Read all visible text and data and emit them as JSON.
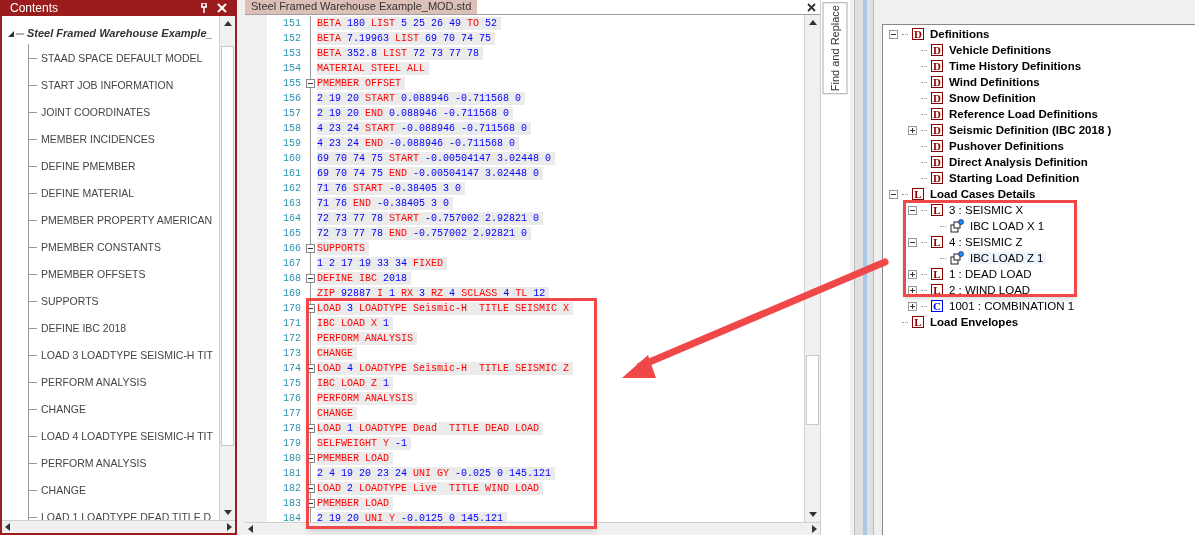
{
  "contents_panel": {
    "title": "Contents",
    "tree": {
      "label": "Steel Framed Warehouse Example_",
      "expanded": true,
      "children": [
        {
          "label": "STAAD SPACE DEFAULT MODEL"
        },
        {
          "label": "START JOB INFORMATION"
        },
        {
          "label": "JOINT COORDINATES"
        },
        {
          "label": "MEMBER INCIDENCES"
        },
        {
          "label": "DEFINE PMEMBER"
        },
        {
          "label": "DEFINE MATERIAL"
        },
        {
          "label": "PMEMBER PROPERTY AMERICAN"
        },
        {
          "label": "PMEMBER CONSTANTS"
        },
        {
          "label": "PMEMBER OFFSETS"
        },
        {
          "label": "SUPPORTS"
        },
        {
          "label": "DEFINE IBC 2018"
        },
        {
          "label": "LOAD 3 LOADTYPE SEISMIC-H TIT"
        },
        {
          "label": "PERFORM ANALYSIS"
        },
        {
          "label": "CHANGE"
        },
        {
          "label": "LOAD 4 LOADTYPE SEISMIC-H TIT"
        },
        {
          "label": "PERFORM ANALYSIS"
        },
        {
          "label": "CHANGE"
        },
        {
          "label": "LOAD 1 LOADTYPE DEAD TITLE D"
        }
      ]
    }
  },
  "editor": {
    "tab": "Steel Framed Warehouse Example_MOD.std",
    "lines": [
      {
        "number": "151",
        "fold": false,
        "segments": [
          {
            "text": "BETA ",
            "kind": "keyword"
          },
          {
            "text": "180 ",
            "kind": "number"
          },
          {
            "text": "LIST ",
            "kind": "keyword"
          },
          {
            "text": "5 25 26 49 ",
            "kind": "number"
          },
          {
            "text": "TO ",
            "kind": "keyword"
          },
          {
            "text": "52",
            "kind": "number"
          }
        ]
      },
      {
        "number": "152",
        "fold": false,
        "segments": [
          {
            "text": "BETA ",
            "kind": "keyword"
          },
          {
            "text": "7.19963 ",
            "kind": "number"
          },
          {
            "text": "LIST ",
            "kind": "keyword"
          },
          {
            "text": "69 70 74 75",
            "kind": "number"
          }
        ]
      },
      {
        "number": "153",
        "fold": false,
        "segments": [
          {
            "text": "BETA ",
            "kind": "keyword"
          },
          {
            "text": "352.8 ",
            "kind": "number"
          },
          {
            "text": "LIST ",
            "kind": "keyword"
          },
          {
            "text": "72 73 77 78",
            "kind": "number"
          }
        ]
      },
      {
        "number": "154",
        "fold": false,
        "segments": [
          {
            "text": "MATERIAL STEEL ALL",
            "kind": "keyword"
          }
        ]
      },
      {
        "number": "155",
        "fold": true,
        "segments": [
          {
            "text": "PMEMBER OFFSET",
            "kind": "keyword"
          }
        ]
      },
      {
        "number": "156",
        "fold": false,
        "segments": [
          {
            "text": "2 19 20 ",
            "kind": "number"
          },
          {
            "text": "START ",
            "kind": "keyword"
          },
          {
            "text": "0.088946 -0.711568 0",
            "kind": "number"
          }
        ]
      },
      {
        "number": "157",
        "fold": false,
        "segments": [
          {
            "text": "2 19 20 ",
            "kind": "number"
          },
          {
            "text": "END ",
            "kind": "keyword"
          },
          {
            "text": "0.088946 -0.711568 0",
            "kind": "number"
          }
        ]
      },
      {
        "number": "158",
        "fold": false,
        "segments": [
          {
            "text": "4 23 24 ",
            "kind": "number"
          },
          {
            "text": "START ",
            "kind": "keyword"
          },
          {
            "text": "-0.088946 -0.711568 0",
            "kind": "number"
          }
        ]
      },
      {
        "number": "159",
        "fold": false,
        "segments": [
          {
            "text": "4 23 24 ",
            "kind": "number"
          },
          {
            "text": "END ",
            "kind": "keyword"
          },
          {
            "text": "-0.088946 -0.711568 0",
            "kind": "number"
          }
        ]
      },
      {
        "number": "160",
        "fold": false,
        "segments": [
          {
            "text": "69 70 74 75 ",
            "kind": "number"
          },
          {
            "text": "START ",
            "kind": "keyword"
          },
          {
            "text": "-0.00504147 3.02448 0",
            "kind": "number"
          }
        ]
      },
      {
        "number": "161",
        "fold": false,
        "segments": [
          {
            "text": "69 70 74 75 ",
            "kind": "number"
          },
          {
            "text": "END ",
            "kind": "keyword"
          },
          {
            "text": "-0.00504147 3.02448 0",
            "kind": "number"
          }
        ]
      },
      {
        "number": "162",
        "fold": false,
        "segments": [
          {
            "text": "71 76 ",
            "kind": "number"
          },
          {
            "text": "START ",
            "kind": "keyword"
          },
          {
            "text": "-0.38405 3 0",
            "kind": "number"
          }
        ]
      },
      {
        "number": "163",
        "fold": false,
        "segments": [
          {
            "text": "71 76 ",
            "kind": "number"
          },
          {
            "text": "END ",
            "kind": "keyword"
          },
          {
            "text": "-0.38405 3 0",
            "kind": "number"
          }
        ]
      },
      {
        "number": "164",
        "fold": false,
        "segments": [
          {
            "text": "72 73 77 78 ",
            "kind": "number"
          },
          {
            "text": "START ",
            "kind": "keyword"
          },
          {
            "text": "-0.757002 2.92821 0",
            "kind": "number"
          }
        ]
      },
      {
        "number": "165",
        "fold": false,
        "segments": [
          {
            "text": "72 73 77 78 ",
            "kind": "number"
          },
          {
            "text": "END ",
            "kind": "keyword"
          },
          {
            "text": "-0.757002 2.92821 0",
            "kind": "number"
          }
        ]
      },
      {
        "number": "166",
        "fold": true,
        "segments": [
          {
            "text": "SUPPORTS",
            "kind": "keyword"
          }
        ]
      },
      {
        "number": "167",
        "fold": false,
        "segments": [
          {
            "text": "1 2 17 19 33 34 ",
            "kind": "number"
          },
          {
            "text": "FIXED",
            "kind": "keyword"
          }
        ]
      },
      {
        "number": "168",
        "fold": true,
        "segments": [
          {
            "text": "DEFINE IBC ",
            "kind": "keyword"
          },
          {
            "text": "2018",
            "kind": "number"
          }
        ]
      },
      {
        "number": "169",
        "fold": false,
        "segments": [
          {
            "text": "ZIP ",
            "kind": "keyword"
          },
          {
            "text": "92887 ",
            "kind": "number"
          },
          {
            "text": "I ",
            "kind": "keyword"
          },
          {
            "text": "1 ",
            "kind": "number"
          },
          {
            "text": "RX ",
            "kind": "keyword"
          },
          {
            "text": "3 ",
            "kind": "number"
          },
          {
            "text": "RZ ",
            "kind": "keyword"
          },
          {
            "text": "4 ",
            "kind": "number"
          },
          {
            "text": "SCLASS ",
            "kind": "keyword"
          },
          {
            "text": "4 ",
            "kind": "number"
          },
          {
            "text": "TL ",
            "kind": "keyword"
          },
          {
            "text": "12",
            "kind": "number"
          }
        ]
      },
      {
        "number": "170",
        "fold": true,
        "segments": [
          {
            "text": "LOAD ",
            "kind": "keyword"
          },
          {
            "text": "3 ",
            "kind": "number"
          },
          {
            "text": "LOADTYPE Seismic-H  TITLE SEISMIC X",
            "kind": "keyword"
          }
        ]
      },
      {
        "number": "171",
        "fold": false,
        "segments": [
          {
            "text": "IBC LOAD X ",
            "kind": "keyword"
          },
          {
            "text": "1",
            "kind": "number"
          }
        ]
      },
      {
        "number": "172",
        "fold": false,
        "segments": [
          {
            "text": "PERFORM ANALYSIS",
            "kind": "keyword"
          }
        ]
      },
      {
        "number": "173",
        "fold": false,
        "segments": [
          {
            "text": "CHANGE",
            "kind": "keyword"
          }
        ]
      },
      {
        "number": "174",
        "fold": true,
        "segments": [
          {
            "text": "LOAD ",
            "kind": "keyword"
          },
          {
            "text": "4 ",
            "kind": "number"
          },
          {
            "text": "LOADTYPE Seismic-H  TITLE SEISMIC Z",
            "kind": "keyword"
          }
        ]
      },
      {
        "number": "175",
        "fold": false,
        "segments": [
          {
            "text": "IBC LOAD Z ",
            "kind": "keyword"
          },
          {
            "text": "1",
            "kind": "number"
          }
        ]
      },
      {
        "number": "176",
        "fold": false,
        "segments": [
          {
            "text": "PERFORM ANALYSIS",
            "kind": "keyword"
          }
        ]
      },
      {
        "number": "177",
        "fold": false,
        "segments": [
          {
            "text": "CHANGE",
            "kind": "keyword"
          }
        ]
      },
      {
        "number": "178",
        "fold": true,
        "segments": [
          {
            "text": "LOAD ",
            "kind": "keyword"
          },
          {
            "text": "1 ",
            "kind": "number"
          },
          {
            "text": "LOADTYPE Dead  TITLE DEAD LOAD",
            "kind": "keyword"
          }
        ]
      },
      {
        "number": "179",
        "fold": false,
        "segments": [
          {
            "text": "SELFWEIGHT Y ",
            "kind": "keyword"
          },
          {
            "text": "-1",
            "kind": "number"
          }
        ]
      },
      {
        "number": "180",
        "fold": true,
        "segments": [
          {
            "text": "PMEMBER LOAD",
            "kind": "keyword"
          }
        ]
      },
      {
        "number": "181",
        "fold": false,
        "segments": [
          {
            "text": "2 4 19 20 23 24 ",
            "kind": "number"
          },
          {
            "text": "UNI GY ",
            "kind": "keyword"
          },
          {
            "text": "-0.025 0 145.121",
            "kind": "number"
          }
        ]
      },
      {
        "number": "182",
        "fold": true,
        "segments": [
          {
            "text": "LOAD ",
            "kind": "keyword"
          },
          {
            "text": "2 ",
            "kind": "number"
          },
          {
            "text": "LOADTYPE Live  TITLE WIND LOAD",
            "kind": "keyword"
          }
        ]
      },
      {
        "number": "183",
        "fold": true,
        "segments": [
          {
            "text": "PMEMBER LOAD",
            "kind": "keyword"
          }
        ]
      },
      {
        "number": "184",
        "fold": false,
        "segments": [
          {
            "text": "2 19 20 ",
            "kind": "number"
          },
          {
            "text": "UNI Y ",
            "kind": "keyword"
          },
          {
            "text": "-0.0125 0 145.121",
            "kind": "number"
          }
        ]
      }
    ]
  },
  "side_tab": {
    "label": "Find and Replace"
  },
  "load_tree": [
    {
      "label": "Definitions",
      "badge": "D",
      "color": "#8b0000",
      "bold": true,
      "expanded": true,
      "children": [
        {
          "label": "Vehicle Definitions",
          "badge": "D",
          "color": "#8b0000",
          "bold": true
        },
        {
          "label": "Time History Definitions",
          "badge": "D",
          "color": "#8b0000",
          "bold": true
        },
        {
          "label": "Wind Definitions",
          "badge": "D",
          "color": "#8b0000",
          "bold": true
        },
        {
          "label": "Snow Definition",
          "badge": "D",
          "color": "#8b0000",
          "bold": true
        },
        {
          "label": "Reference Load Definitions",
          "badge": "D",
          "color": "#8b0000",
          "bold": true
        },
        {
          "label": "Seismic Definition (IBC 2018 )",
          "badge": "D",
          "color": "#8b0000",
          "bold": true,
          "expanded": false
        },
        {
          "label": "Pushover Definitions",
          "badge": "D",
          "color": "#8b0000",
          "bold": true
        },
        {
          "label": "Direct Analysis Definition",
          "badge": "D",
          "color": "#8b0000",
          "bold": true
        },
        {
          "label": "Starting Load Definition",
          "badge": "D",
          "color": "#8b0000",
          "bold": true
        }
      ]
    },
    {
      "label": "Load Cases Details",
      "badge": "L",
      "color": "#8b0000",
      "bold": true,
      "expanded": true,
      "children": [
        {
          "label": "3 : SEISMIC X",
          "badge": "L",
          "color": "#8b0000",
          "bold": false,
          "expanded": true,
          "children": [
            {
              "label": "IBC LOAD X 1",
              "bold": false,
              "selected": false
            }
          ]
        },
        {
          "label": "4 : SEISMIC Z",
          "badge": "L",
          "color": "#8b0000",
          "bold": false,
          "expanded": true,
          "children": [
            {
              "label": "IBC LOAD Z 1",
              "bold": false,
              "selected": true
            }
          ]
        },
        {
          "label": "1 : DEAD LOAD",
          "badge": "L",
          "color": "#8b0000",
          "bold": false,
          "expanded": false
        },
        {
          "label": "2 : WIND LOAD",
          "badge": "L",
          "color": "#8b0000",
          "bold": false,
          "expanded": false
        },
        {
          "label": "1001 : COMBINATION 1",
          "badge": "C",
          "color": "#0000ff",
          "bold": false,
          "expanded": false
        }
      ]
    },
    {
      "label": "Load Envelopes",
      "badge": "L",
      "color": "#8b0000",
      "bold": true
    }
  ]
}
